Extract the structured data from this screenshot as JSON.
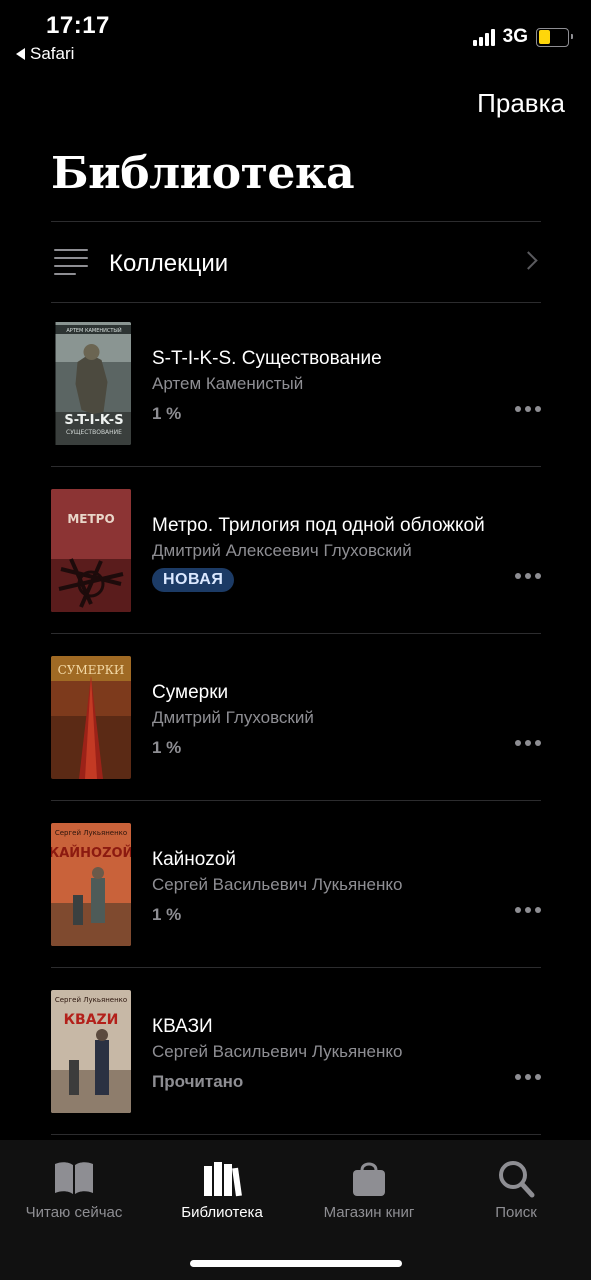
{
  "status_bar": {
    "time": "17:17",
    "back_app": "Safari",
    "network": "3G",
    "battery_level": 0.4,
    "battery_color": "#ffd60a"
  },
  "header": {
    "edit_label": "Правка",
    "title": "Библиотека"
  },
  "collections": {
    "label": "Коллекции",
    "icon": "list-icon"
  },
  "books": [
    {
      "title": "S-T-I-K-S. Существование",
      "author": "Артем Каменистый",
      "status": "1 %",
      "badge": ""
    },
    {
      "title": "Метро. Трилогия под одной обложкой",
      "author": "Дмитрий Алексеевич Глуховский",
      "status": "",
      "badge": "НОВАЯ"
    },
    {
      "title": "Сумерки",
      "author": "Дмитрий Глуховский",
      "status": "1 %",
      "badge": ""
    },
    {
      "title": "Кайноzой",
      "author": "Сергей Васильевич Лукьяненко",
      "status": "1 %",
      "badge": ""
    },
    {
      "title": "КВАЗИ",
      "author": "Сергей Васильевич Лукьяненко",
      "status": "Прочитано",
      "badge": ""
    }
  ],
  "covers": [
    {
      "top_text": "АРТЕМ КАМЕНИСТЫЙ",
      "title": "S-T-I-K-S",
      "subtitle": "СУЩЕСТВОВАНИЕ"
    },
    {
      "title": "МЕТРО"
    },
    {
      "title": "СУМЕРКИ"
    },
    {
      "top_text": "Сергей Лукьяненко",
      "title": "КАЙНОZОЙ"
    },
    {
      "top_text": "Сергей Лукьяненко",
      "title": "КВАZИ"
    }
  ],
  "tabs": [
    {
      "label": "Читаю сейчас",
      "icon": "open-book-icon",
      "active": false
    },
    {
      "label": "Библиотека",
      "icon": "books-icon",
      "active": true
    },
    {
      "label": "Магазин книг",
      "icon": "shopping-bag-icon",
      "active": false
    },
    {
      "label": "Поиск",
      "icon": "search-icon",
      "active": false
    }
  ],
  "colors": {
    "background": "#000000",
    "secondary_text": "#8e8e93",
    "badge_bg": "#1c3b66"
  }
}
